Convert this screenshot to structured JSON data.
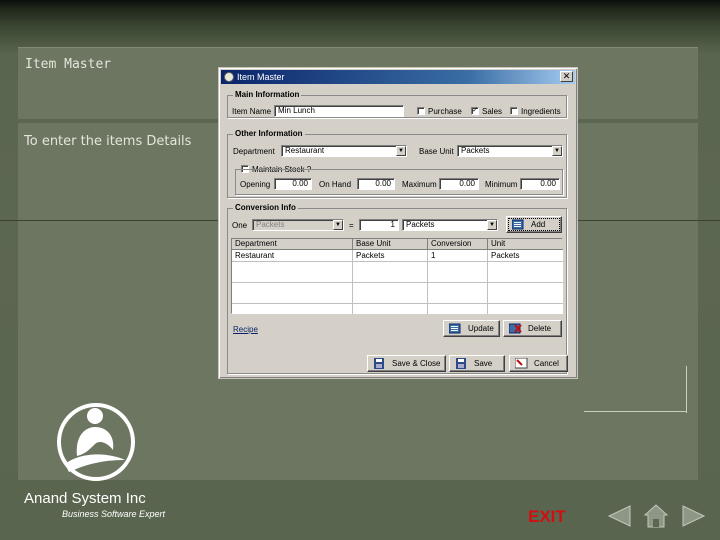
{
  "slide": {
    "header_title": "Item Master",
    "description": "To enter the items Details",
    "company_name": "Anand System Inc",
    "tagline": "Business Software Expert",
    "exit_label": "EXIT"
  },
  "dialog": {
    "title": "Item Master",
    "close_label": "✕",
    "main_info": {
      "title": "Main Information",
      "item_name_label": "Item Name",
      "item_name_value": "Min Lunch",
      "purchase_label": "Purchase",
      "purchase_checked": false,
      "sales_label": "Sales",
      "sales_checked": true,
      "ingredients_label": "Ingredients",
      "ingredients_checked": false
    },
    "other_info": {
      "title": "Other Information",
      "department_label": "Department",
      "department_value": "Restaurant",
      "base_unit_label": "Base Unit",
      "base_unit_value": "Packets",
      "maintain_stock_label": "Maintain Stock ?",
      "maintain_stock_checked": false,
      "opening_label": "Opening",
      "opening_value": "0.00",
      "on_hand_label": "On Hand",
      "on_hand_value": "0.00",
      "maximum_label": "Maximum",
      "maximum_value": "0.00",
      "minimum_label": "Minimum",
      "minimum_value": "0.00"
    },
    "conversion": {
      "title": "Conversion Info",
      "one_label": "One",
      "from_unit": "Packets",
      "equals": "=",
      "quantity": "1",
      "to_unit": "Packets",
      "add_label": "Add"
    },
    "table": {
      "columns": [
        "Department",
        "Base Unit",
        "Conversion",
        "Unit"
      ],
      "rows": [
        [
          "Restaurant",
          "Packets",
          "1",
          "Packets"
        ]
      ]
    },
    "recipe_label": "Recipe",
    "update_label": "Update",
    "delete_label": "Delete",
    "save_close_label": "Save & Close",
    "save_label": "Save",
    "cancel_label": "Cancel"
  },
  "icons": {
    "accent": "#0a246a",
    "exit_color": "#d01010",
    "nav": [
      "previous-icon",
      "home-icon",
      "next-icon"
    ]
  }
}
